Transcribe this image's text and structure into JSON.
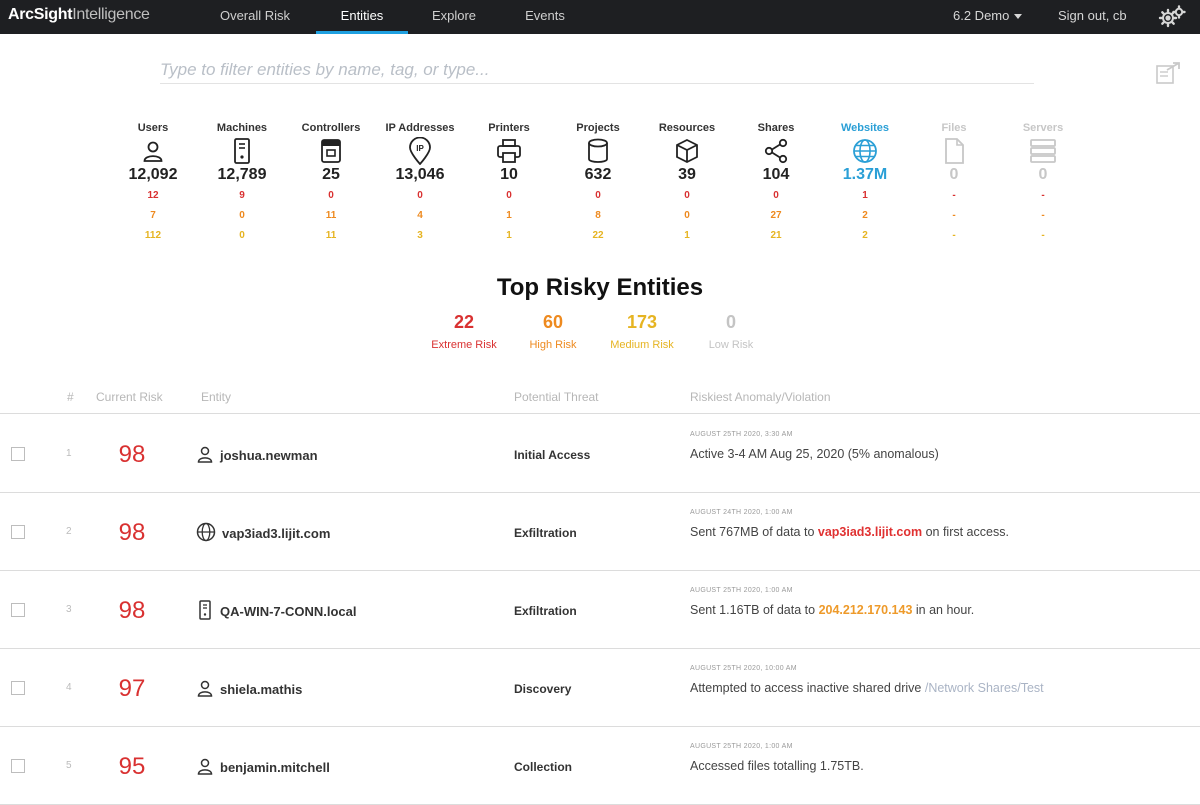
{
  "app": {
    "brand_bold": "ArcSight",
    "brand_light": "Intelligence"
  },
  "nav": {
    "tabs": [
      "Overall Risk",
      "Entities",
      "Explore",
      "Events"
    ],
    "active": "Entities",
    "demo_label": "6.2 Demo",
    "signout_label": "Sign out, cb"
  },
  "filter": {
    "placeholder": "Type to filter entities by name, tag, or type..."
  },
  "categories": [
    {
      "label": "Users",
      "icon": "user-icon",
      "count": "12,092",
      "extreme": "12",
      "high": "7",
      "medium": "112"
    },
    {
      "label": "Machines",
      "icon": "machine-icon",
      "count": "12,789",
      "extreme": "9",
      "high": "0",
      "medium": "0"
    },
    {
      "label": "Controllers",
      "icon": "controller-icon",
      "count": "25",
      "extreme": "0",
      "high": "11",
      "medium": "11"
    },
    {
      "label": "IP Addresses",
      "icon": "ip-pin-icon",
      "count": "13,046",
      "extreme": "0",
      "high": "4",
      "medium": "3"
    },
    {
      "label": "Printers",
      "icon": "printer-icon",
      "count": "10",
      "extreme": "0",
      "high": "1",
      "medium": "1"
    },
    {
      "label": "Projects",
      "icon": "database-icon",
      "count": "632",
      "extreme": "0",
      "high": "8",
      "medium": "22"
    },
    {
      "label": "Resources",
      "icon": "cube-icon",
      "count": "39",
      "extreme": "0",
      "high": "0",
      "medium": "1"
    },
    {
      "label": "Shares",
      "icon": "share-icon",
      "count": "104",
      "extreme": "0",
      "high": "27",
      "medium": "21"
    },
    {
      "label": "Websites",
      "icon": "globe-icon",
      "count": "1.37M",
      "extreme": "1",
      "high": "2",
      "medium": "2"
    },
    {
      "label": "Files",
      "icon": "file-icon",
      "count": "0",
      "extreme": "-",
      "high": "-",
      "medium": "-"
    },
    {
      "label": "Servers",
      "icon": "server-icon",
      "count": "0",
      "extreme": "-",
      "high": "-",
      "medium": "-"
    }
  ],
  "top_risky": {
    "title": "Top Risky Entities",
    "summary": [
      {
        "value": "22",
        "label": "Extreme Risk",
        "color": "#d93131"
      },
      {
        "value": "60",
        "label": "High Risk",
        "color": "#ee8a1f"
      },
      {
        "value": "173",
        "label": "Medium Risk",
        "color": "#e6b422"
      },
      {
        "value": "0",
        "label": "Low Risk",
        "color": "#c4c4c4"
      }
    ]
  },
  "table": {
    "headers": [
      "#",
      "Current Risk",
      "Entity",
      "Potential Threat",
      "Riskiest Anomaly/Violation"
    ],
    "rows": [
      {
        "rank": "1",
        "score": "98",
        "icon": "user-icon",
        "entity": "joshua.newman",
        "threat": "Initial Access",
        "date": "AUGUST 25TH 2020, 3:30 AM",
        "text_before": "Active 3-4 AM Aug 25, 2020 (5% anomalous)",
        "highlight": "",
        "text_after": "",
        "hl_style": ""
      },
      {
        "rank": "2",
        "score": "98",
        "icon": "globe-icon",
        "entity": "vap3iad3.lijit.com",
        "threat": "Exfiltration",
        "date": "AUGUST 24TH 2020, 1:00 AM",
        "text_before": "Sent 767MB of data to ",
        "highlight": "vap3iad3.lijit.com",
        "text_after": " on first access.",
        "hl_style": "red"
      },
      {
        "rank": "3",
        "score": "98",
        "icon": "machine-icon",
        "entity": "QA-WIN-7-CONN.local",
        "threat": "Exfiltration",
        "date": "AUGUST 25TH 2020, 1:00 AM",
        "text_before": "Sent 1.16TB of data to ",
        "highlight": "204.212.170.143",
        "text_after": " in an hour.",
        "hl_style": "orange"
      },
      {
        "rank": "4",
        "score": "97",
        "icon": "user-icon",
        "entity": "shiela.mathis",
        "threat": "Discovery",
        "date": "AUGUST 25TH 2020, 10:00 AM",
        "text_before": "Attempted to access inactive shared drive ",
        "highlight": "/Network Shares/Test",
        "text_after": "",
        "hl_style": "link"
      },
      {
        "rank": "5",
        "score": "95",
        "icon": "user-icon",
        "entity": "benjamin.mitchell",
        "threat": "Collection",
        "date": "AUGUST 25TH 2020, 1:00 AM",
        "text_before": "Accessed files totalling 1.75TB.",
        "highlight": "",
        "text_after": "",
        "hl_style": ""
      }
    ]
  }
}
